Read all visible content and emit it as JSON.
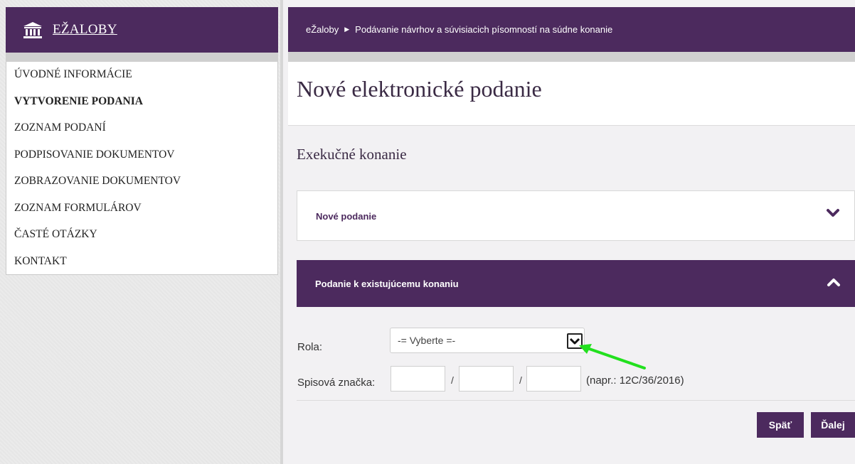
{
  "brand": {
    "name": "EŽALOBY",
    "icon": "courthouse-icon"
  },
  "sidebar": {
    "items": [
      {
        "label": "ÚVODNÉ INFORMÁCIE"
      },
      {
        "label": "VYTVORENIE PODANIA",
        "active": true
      },
      {
        "label": "ZOZNAM PODANÍ"
      },
      {
        "label": "PODPISOVANIE DOKUMENTOV"
      },
      {
        "label": "ZOBRAZOVANIE DOKUMENTOV"
      },
      {
        "label": "ZOZNAM FORMULÁROV"
      },
      {
        "label": "ČASTÉ OTÁZKY"
      },
      {
        "label": "KONTAKT"
      }
    ]
  },
  "breadcrumb": {
    "root": "eŽaloby",
    "separator_icon": "triangle-right-icon",
    "current": "Podávanie návrhov a súvisiacich písomností na súdne konanie"
  },
  "page": {
    "title": "Nové elektronické podanie",
    "section_title": "Exekučné konanie"
  },
  "accordions": {
    "new": {
      "label": "Nové podanie",
      "icon": "chevron-down-icon",
      "expanded": false
    },
    "existing": {
      "label": "Podanie k existujúcemu konaniu",
      "icon": "chevron-up-icon",
      "expanded": true
    }
  },
  "form": {
    "role_label": "Rola:",
    "role_selected": "-= Vyberte =-",
    "case_label": "Spisová značka:",
    "separator": "/",
    "case_hint": "(napr.: 12C/36/2016)"
  },
  "buttons": {
    "back": "Späť",
    "next": "Ďalej"
  },
  "colors": {
    "brand": "#4c2a5e",
    "annotation_arrow": "#22e01e"
  }
}
